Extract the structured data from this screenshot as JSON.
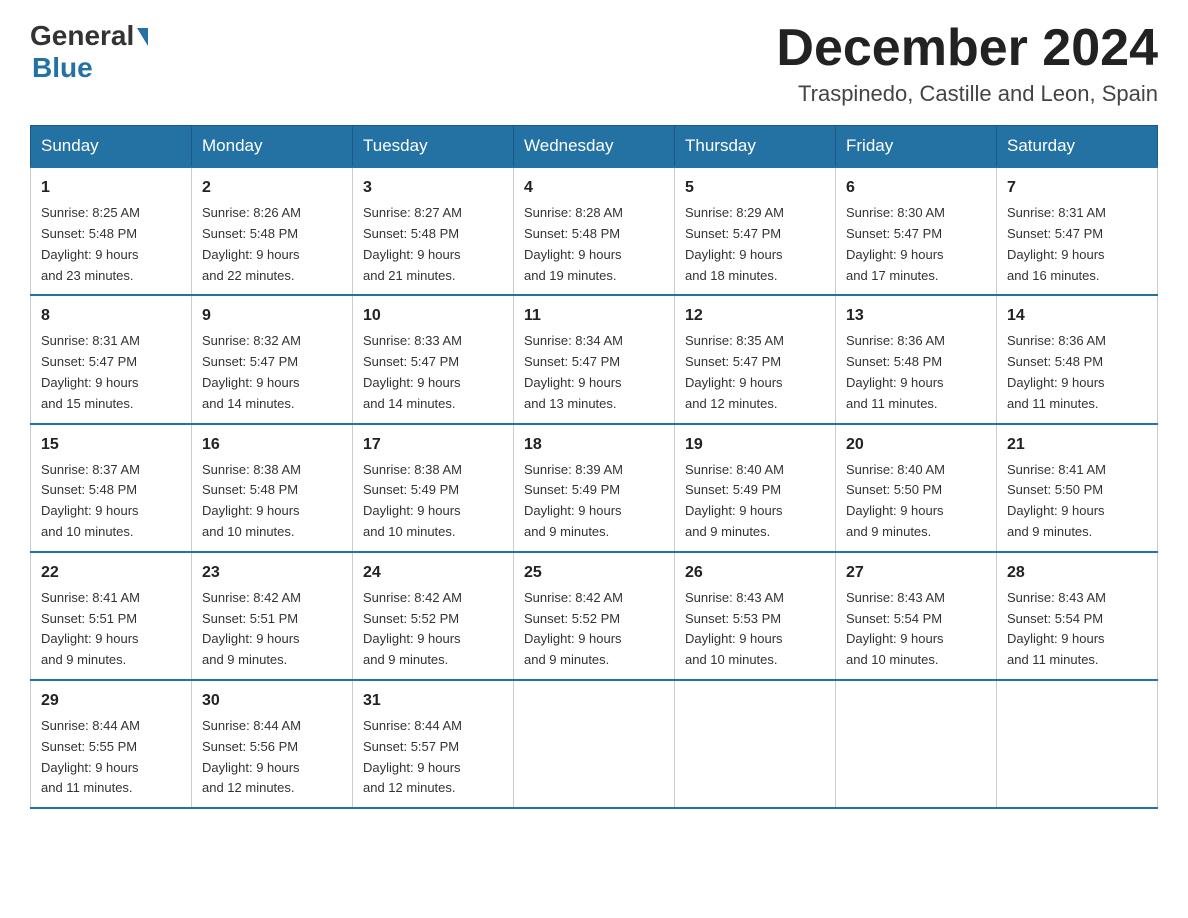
{
  "header": {
    "logo_general": "General",
    "logo_blue": "Blue",
    "month_title": "December 2024",
    "location": "Traspinedo, Castille and Leon, Spain"
  },
  "weekdays": [
    "Sunday",
    "Monday",
    "Tuesday",
    "Wednesday",
    "Thursday",
    "Friday",
    "Saturday"
  ],
  "weeks": [
    [
      {
        "day": "1",
        "sunrise": "8:25 AM",
        "sunset": "5:48 PM",
        "daylight": "9 hours and 23 minutes."
      },
      {
        "day": "2",
        "sunrise": "8:26 AM",
        "sunset": "5:48 PM",
        "daylight": "9 hours and 22 minutes."
      },
      {
        "day": "3",
        "sunrise": "8:27 AM",
        "sunset": "5:48 PM",
        "daylight": "9 hours and 21 minutes."
      },
      {
        "day": "4",
        "sunrise": "8:28 AM",
        "sunset": "5:48 PM",
        "daylight": "9 hours and 19 minutes."
      },
      {
        "day": "5",
        "sunrise": "8:29 AM",
        "sunset": "5:47 PM",
        "daylight": "9 hours and 18 minutes."
      },
      {
        "day": "6",
        "sunrise": "8:30 AM",
        "sunset": "5:47 PM",
        "daylight": "9 hours and 17 minutes."
      },
      {
        "day": "7",
        "sunrise": "8:31 AM",
        "sunset": "5:47 PM",
        "daylight": "9 hours and 16 minutes."
      }
    ],
    [
      {
        "day": "8",
        "sunrise": "8:31 AM",
        "sunset": "5:47 PM",
        "daylight": "9 hours and 15 minutes."
      },
      {
        "day": "9",
        "sunrise": "8:32 AM",
        "sunset": "5:47 PM",
        "daylight": "9 hours and 14 minutes."
      },
      {
        "day": "10",
        "sunrise": "8:33 AM",
        "sunset": "5:47 PM",
        "daylight": "9 hours and 14 minutes."
      },
      {
        "day": "11",
        "sunrise": "8:34 AM",
        "sunset": "5:47 PM",
        "daylight": "9 hours and 13 minutes."
      },
      {
        "day": "12",
        "sunrise": "8:35 AM",
        "sunset": "5:47 PM",
        "daylight": "9 hours and 12 minutes."
      },
      {
        "day": "13",
        "sunrise": "8:36 AM",
        "sunset": "5:48 PM",
        "daylight": "9 hours and 11 minutes."
      },
      {
        "day": "14",
        "sunrise": "8:36 AM",
        "sunset": "5:48 PM",
        "daylight": "9 hours and 11 minutes."
      }
    ],
    [
      {
        "day": "15",
        "sunrise": "8:37 AM",
        "sunset": "5:48 PM",
        "daylight": "9 hours and 10 minutes."
      },
      {
        "day": "16",
        "sunrise": "8:38 AM",
        "sunset": "5:48 PM",
        "daylight": "9 hours and 10 minutes."
      },
      {
        "day": "17",
        "sunrise": "8:38 AM",
        "sunset": "5:49 PM",
        "daylight": "9 hours and 10 minutes."
      },
      {
        "day": "18",
        "sunrise": "8:39 AM",
        "sunset": "5:49 PM",
        "daylight": "9 hours and 9 minutes."
      },
      {
        "day": "19",
        "sunrise": "8:40 AM",
        "sunset": "5:49 PM",
        "daylight": "9 hours and 9 minutes."
      },
      {
        "day": "20",
        "sunrise": "8:40 AM",
        "sunset": "5:50 PM",
        "daylight": "9 hours and 9 minutes."
      },
      {
        "day": "21",
        "sunrise": "8:41 AM",
        "sunset": "5:50 PM",
        "daylight": "9 hours and 9 minutes."
      }
    ],
    [
      {
        "day": "22",
        "sunrise": "8:41 AM",
        "sunset": "5:51 PM",
        "daylight": "9 hours and 9 minutes."
      },
      {
        "day": "23",
        "sunrise": "8:42 AM",
        "sunset": "5:51 PM",
        "daylight": "9 hours and 9 minutes."
      },
      {
        "day": "24",
        "sunrise": "8:42 AM",
        "sunset": "5:52 PM",
        "daylight": "9 hours and 9 minutes."
      },
      {
        "day": "25",
        "sunrise": "8:42 AM",
        "sunset": "5:52 PM",
        "daylight": "9 hours and 9 minutes."
      },
      {
        "day": "26",
        "sunrise": "8:43 AM",
        "sunset": "5:53 PM",
        "daylight": "9 hours and 10 minutes."
      },
      {
        "day": "27",
        "sunrise": "8:43 AM",
        "sunset": "5:54 PM",
        "daylight": "9 hours and 10 minutes."
      },
      {
        "day": "28",
        "sunrise": "8:43 AM",
        "sunset": "5:54 PM",
        "daylight": "9 hours and 11 minutes."
      }
    ],
    [
      {
        "day": "29",
        "sunrise": "8:44 AM",
        "sunset": "5:55 PM",
        "daylight": "9 hours and 11 minutes."
      },
      {
        "day": "30",
        "sunrise": "8:44 AM",
        "sunset": "5:56 PM",
        "daylight": "9 hours and 12 minutes."
      },
      {
        "day": "31",
        "sunrise": "8:44 AM",
        "sunset": "5:57 PM",
        "daylight": "9 hours and 12 minutes."
      },
      null,
      null,
      null,
      null
    ]
  ],
  "labels": {
    "sunrise": "Sunrise:",
    "sunset": "Sunset:",
    "daylight": "Daylight:"
  }
}
